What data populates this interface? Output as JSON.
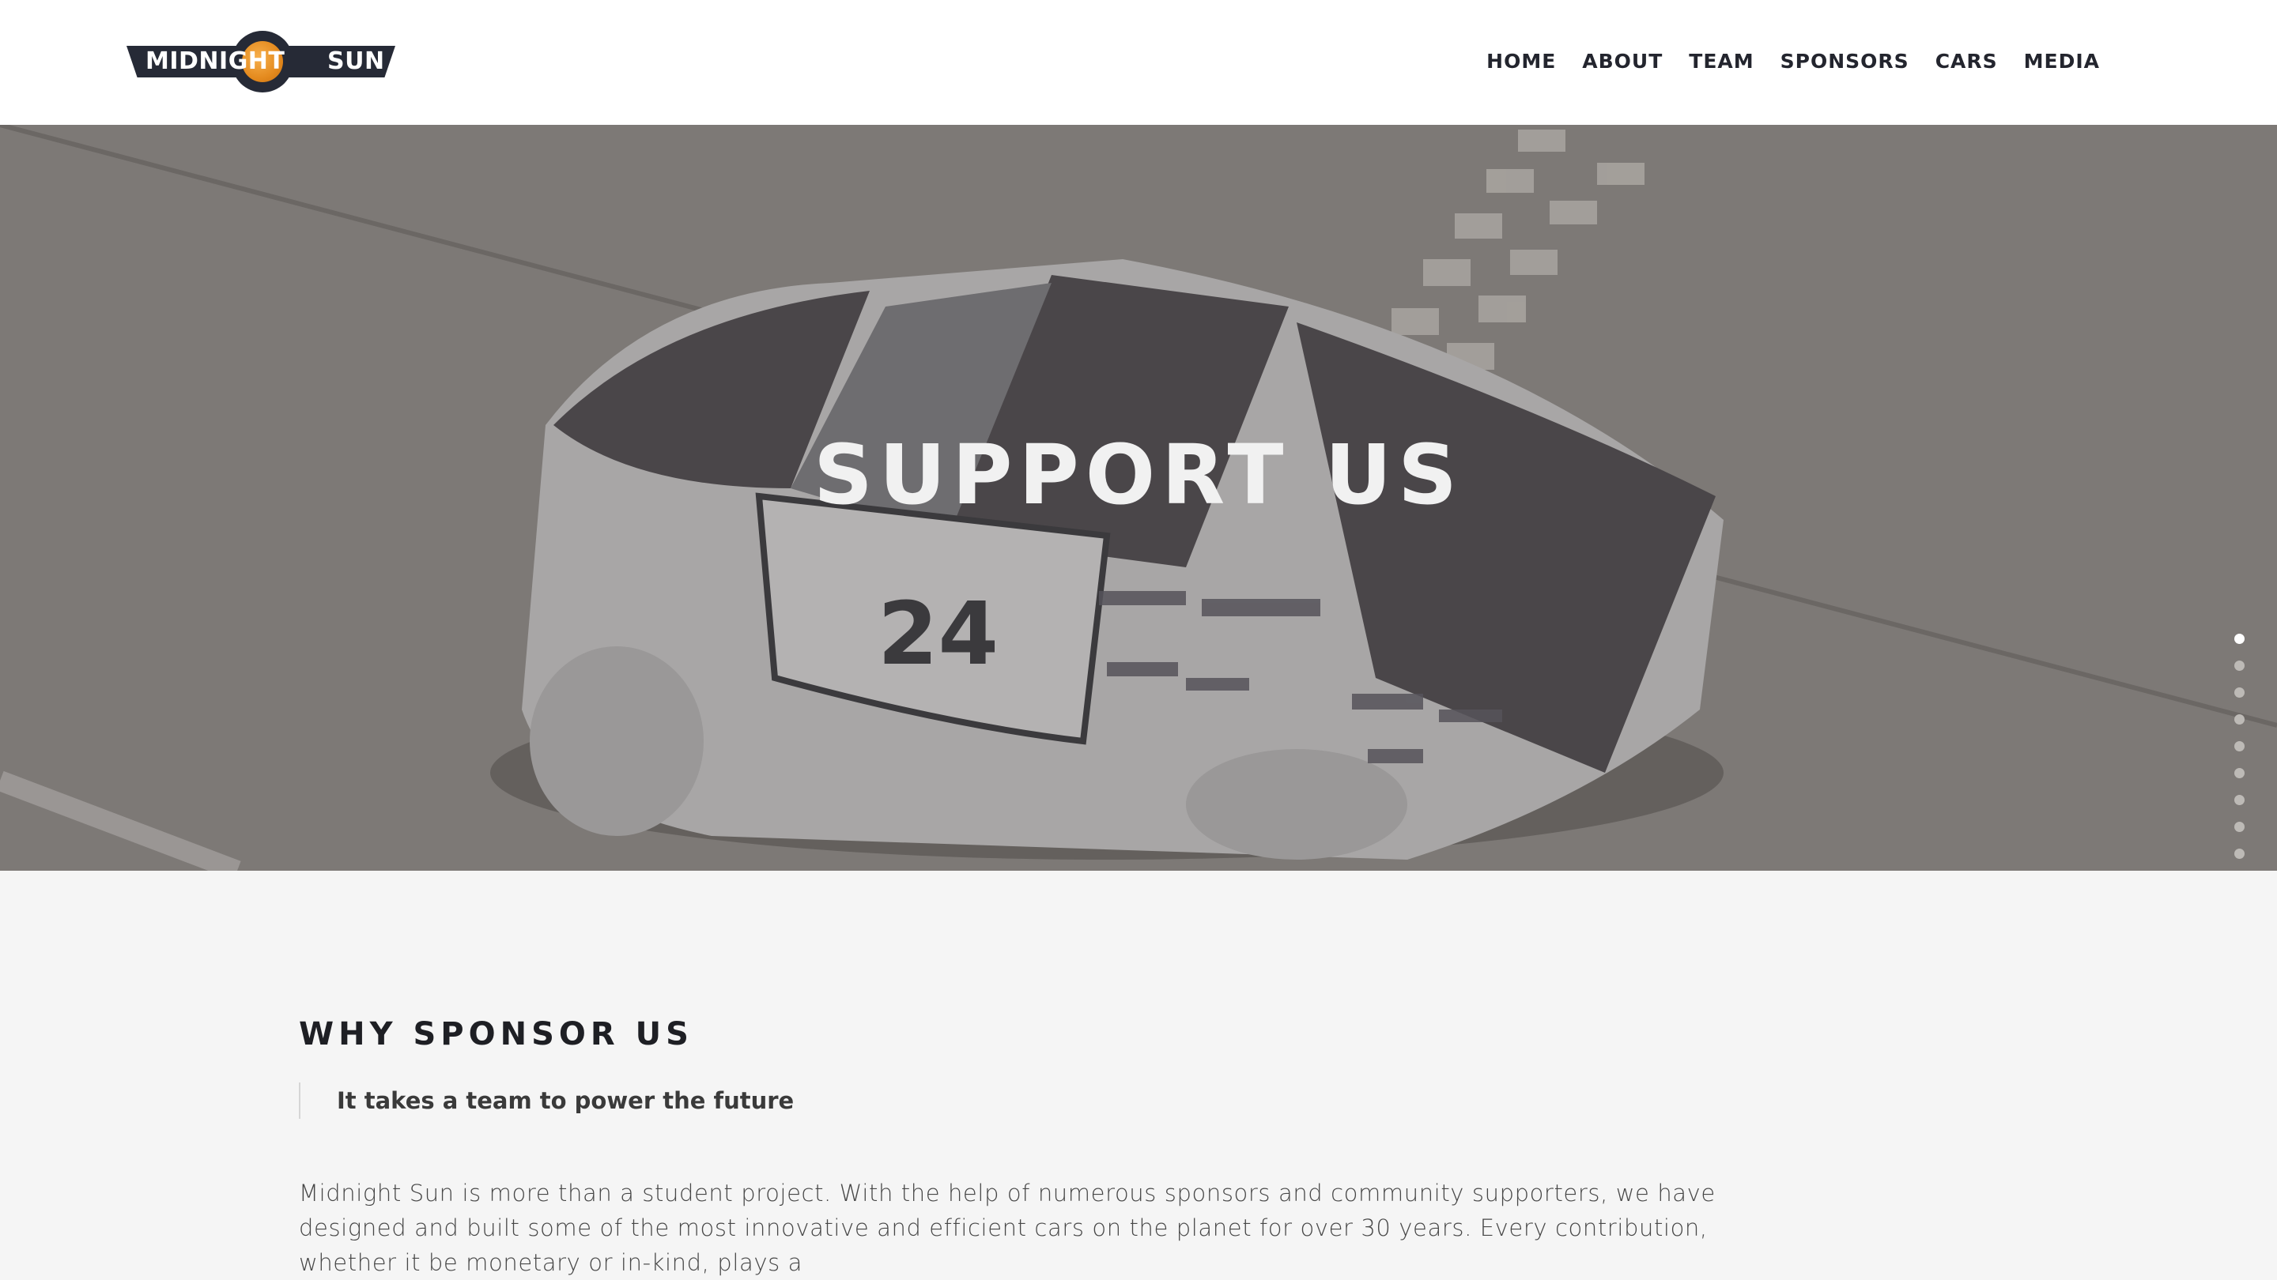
{
  "header": {
    "logo": {
      "left": "MIDNIGHT",
      "right": "SUN"
    },
    "nav": [
      "HOME",
      "ABOUT",
      "TEAM",
      "SPONSORS",
      "CARS",
      "MEDIA"
    ]
  },
  "hero": {
    "title": "SUPPORT US",
    "car_number": "24",
    "slide_dots": 9,
    "active_dot": 0
  },
  "section": {
    "heading": "WHY SPONSOR US",
    "tagline": "It takes a team to power the future",
    "paragraph": "Midnight Sun is more than a student project. With the help of numerous sponsors and community supporters, we have designed and built some of the most innovative and efficient cars on the planet for over 30 years. Every contribution, whether it be monetary or in-kind, plays a"
  },
  "colors": {
    "header_bg": "#ffffff",
    "logo_dark": "#262a36",
    "sun": "#e48a1e",
    "page_bg": "#f5f5f5"
  }
}
